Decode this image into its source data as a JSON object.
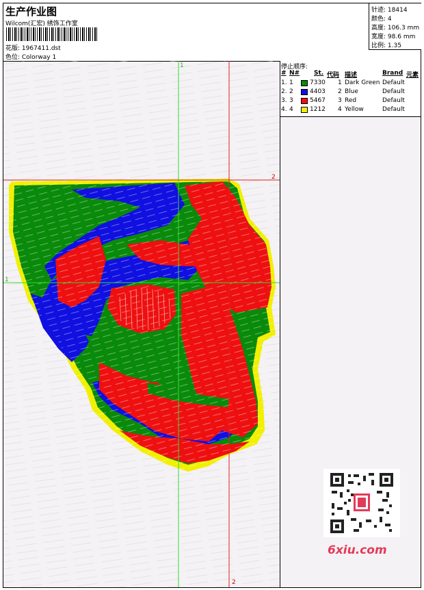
{
  "header": {
    "title": "生产作业图",
    "company": "Wilcom(汇宏) 绣饰工作室",
    "design_label": "花版: 1967411.dst",
    "colorway_label": "色位: Colorway 1"
  },
  "stats": [
    {
      "label": "针迹:",
      "value": "18414"
    },
    {
      "label": "颜色:",
      "value": "4"
    },
    {
      "label": "高度:",
      "value": "106.3 mm"
    },
    {
      "label": "宽度:",
      "value": "98.6 mm"
    },
    {
      "label": "比例:",
      "value": "1.35"
    }
  ],
  "stop_sequence": {
    "title": "停止顺序:",
    "headers": {
      "num": "#",
      "no": "N#",
      "st": "St.",
      "code": "代码",
      "desc": "描述",
      "brand": "Brand",
      "elem": "元素"
    },
    "rows": [
      {
        "num": "1.",
        "no": "1",
        "color": "#0a8a0a",
        "st": "7330",
        "code": "1",
        "desc": "Dark Green",
        "brand": "Default"
      },
      {
        "num": "2.",
        "no": "2",
        "color": "#1010e0",
        "st": "4403",
        "code": "2",
        "desc": "Blue",
        "brand": "Default"
      },
      {
        "num": "3.",
        "no": "3",
        "color": "#ee1010",
        "st": "5467",
        "code": "3",
        "desc": "Red",
        "brand": "Default"
      },
      {
        "num": "4.",
        "no": "4",
        "color": "#f0f000",
        "st": "1212",
        "code": "4",
        "desc": "Yellow",
        "brand": "Default"
      }
    ]
  },
  "guides": {
    "green_v_label": "1",
    "green_h_label": "1",
    "red_h_label": "2",
    "red_v_label": "2"
  },
  "watermark": "6xiu.com"
}
